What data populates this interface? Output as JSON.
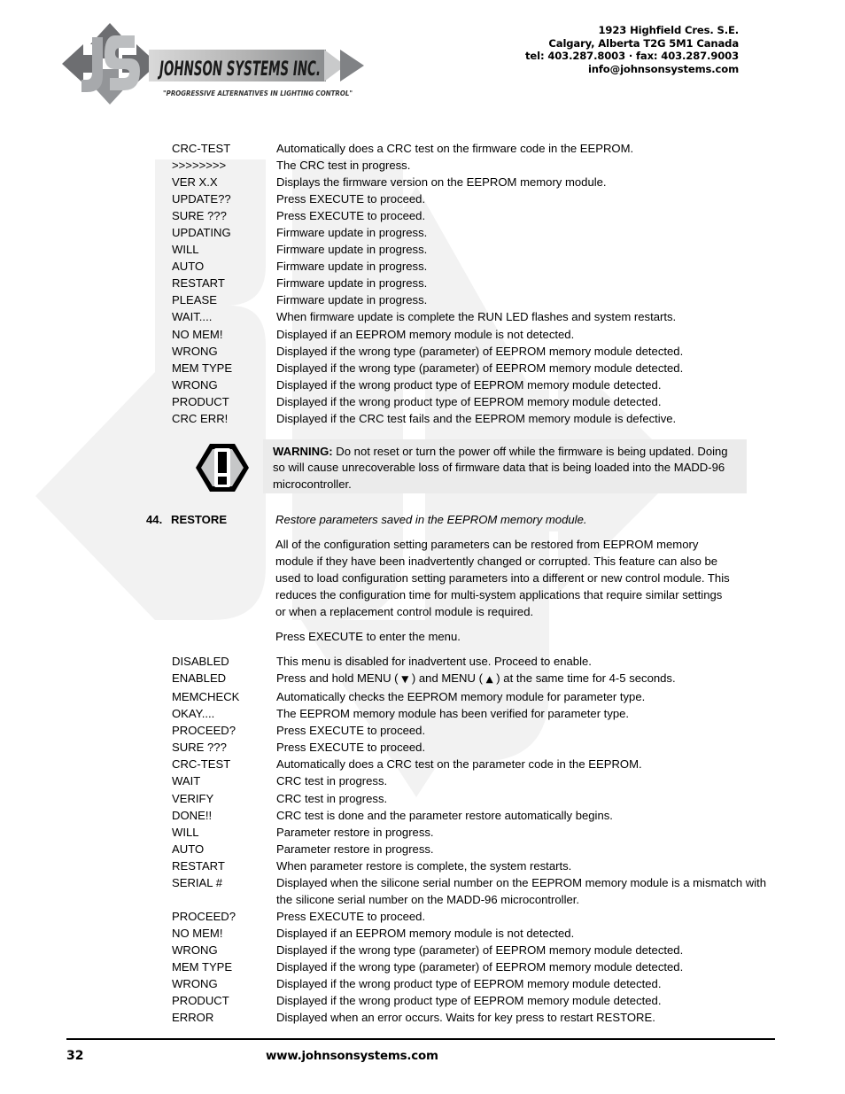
{
  "header": {
    "logo_text": "JOHNSON SYSTEMS INC.",
    "tagline": "\"PROGRESSIVE ALTERNATIVES IN LIGHTING CONTROL\"",
    "contact": {
      "address_line1": "1923 Highfield Cres. S.E.",
      "address_line2": "Calgary, Alberta  T2G 5M1 Canada",
      "phone_line": "tel: 403.287.8003 · fax: 403.287.9003",
      "email": "info@johnsonsystems.com"
    }
  },
  "update_rows": [
    {
      "term": "CRC-TEST",
      "desc": "Automatically does a CRC test on the firmware code in the EEPROM."
    },
    {
      "term": ">>>>>>>>",
      "desc": "The CRC test in progress."
    },
    {
      "term": "VER X.X",
      "desc": "Displays the firmware version on the EEPROM memory module."
    },
    {
      "term": "UPDATE??",
      "desc": "Press EXECUTE to proceed."
    },
    {
      "term": "SURE ???",
      "desc": "Press EXECUTE to proceed."
    },
    {
      "term": "UPDATING",
      "desc": "Firmware update in progress."
    },
    {
      "term": "WILL",
      "desc": "Firmware update in progress."
    },
    {
      "term": "AUTO",
      "desc": "Firmware update in progress."
    },
    {
      "term": "RESTART",
      "desc": "Firmware update in progress."
    },
    {
      "term": "PLEASE",
      "desc": "Firmware update in progress."
    },
    {
      "term": "WAIT....",
      "desc": "When firmware update is complete the RUN LED flashes and system restarts."
    },
    {
      "term": "NO MEM!",
      "desc": "Displayed if an EEPROM memory module is not detected."
    },
    {
      "term": "WRONG",
      "desc": "Displayed if the wrong type (parameter) of EEPROM memory module detected."
    },
    {
      "term": "MEM TYPE",
      "desc": "Displayed if the wrong type (parameter) of EEPROM memory module detected."
    },
    {
      "term": "WRONG",
      "desc": "Displayed if the wrong product type of EEPROM memory module detected."
    },
    {
      "term": "PRODUCT",
      "desc": "Displayed if the wrong product type of EEPROM memory module detected."
    },
    {
      "term": "CRC ERR!",
      "desc": "Displayed if the CRC test fails and the EEPROM memory module is defective."
    }
  ],
  "warning": {
    "label": "WARNING:",
    "text": " Do not reset or turn the power off while the firmware is being updated. Doing so will cause unrecoverable loss of firmware data that is being loaded into the MADD-96 microcontroller.",
    "icon": "warning-exclamation-icon",
    "background_color": "#ebebeb"
  },
  "section": {
    "number": "44.",
    "title": "RESTORE",
    "subtitle": "Restore parameters saved in the EEPROM memory module.",
    "paragraph": "All of the configuration setting parameters can be restored from EEPROM memory module if they have been inadvertently changed or corrupted. This feature can also be used to load configuration setting parameters into a different or new control module. This reduces the configuration time for multi-system applications that require similar settings or when a replacement control module is required.",
    "instruction": "Press EXECUTE to enter the menu."
  },
  "restore_rows": [
    {
      "term": "DISABLED",
      "desc": "This menu is disabled for inadvertent use. Proceed to enable."
    },
    {
      "term": "ENABLED",
      "desc": "Press and hold MENU ( ↓ ) and MENU ( ↑ ) at the same time for 4-5 seconds.",
      "desc_pre": "Press and hold MENU ( ",
      "arrow_down": "▼",
      "desc_mid": " ) and MENU ( ",
      "arrow_up": "▲",
      "desc_post": " ) at the same time for 4-5 seconds."
    },
    {
      "term": "MEMCHECK",
      "desc": "Automatically checks the EEPROM memory module for parameter type."
    },
    {
      "term": "OKAY....",
      "desc": "The EEPROM memory module has been verified for parameter type."
    },
    {
      "term": "PROCEED?",
      "desc": "Press EXECUTE to proceed."
    },
    {
      "term": "SURE ???",
      "desc": "Press EXECUTE to proceed."
    },
    {
      "term": "CRC-TEST",
      "desc": "Automatically does a CRC test on the parameter code in the EEPROM."
    },
    {
      "term": "WAIT",
      "desc": "CRC test in progress."
    },
    {
      "term": "VERIFY",
      "desc": "CRC test in progress."
    },
    {
      "term": "DONE!!",
      "desc": "CRC test is done and the parameter restore automatically begins."
    },
    {
      "term": "WILL",
      "desc": "Parameter restore in progress."
    },
    {
      "term": "AUTO",
      "desc": "Parameter restore in progress."
    },
    {
      "term": "RESTART",
      "desc": "When parameter restore is complete, the system restarts."
    },
    {
      "term": "SERIAL #",
      "desc": "Displayed when the silicone serial number on the EEPROM memory module is a mismatch with the silicone serial number on the MADD-96 microcontroller."
    },
    {
      "term": "PROCEED?",
      "desc": "Press EXECUTE to proceed."
    },
    {
      "term": "NO MEM!",
      "desc": "Displayed if an EEPROM memory module is not detected."
    },
    {
      "term": "WRONG",
      "desc": "Displayed if the wrong type (parameter) of EEPROM memory module detected."
    },
    {
      "term": "MEM TYPE",
      "desc": "Displayed if the wrong type (parameter) of EEPROM memory module detected."
    },
    {
      "term": "WRONG",
      "desc": "Displayed if the wrong product type of EEPROM memory module detected."
    },
    {
      "term": "PRODUCT",
      "desc": "Displayed if the wrong product type of EEPROM memory module detected."
    },
    {
      "term": "ERROR",
      "desc": "Displayed when an error occurs. Waits for key press to restart RESTORE."
    }
  ],
  "footer": {
    "page_number": "32",
    "url": "www.johnsonsystems.com"
  },
  "colors": {
    "text": "#000000",
    "warning_bg": "#ebebeb",
    "watermark": "#f2f2f2",
    "logo_dark": "#58585a",
    "logo_light": "#a7a9ac"
  }
}
